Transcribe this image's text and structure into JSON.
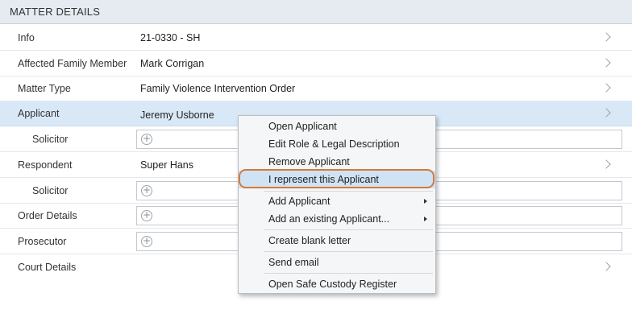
{
  "header": {
    "title": "MATTER DETAILS"
  },
  "rows": {
    "info": {
      "label": "Info",
      "value": "21-0330 - SH"
    },
    "affected": {
      "label": "Affected Family Member",
      "value": "Mark Corrigan"
    },
    "matter_type": {
      "label": "Matter Type",
      "value": "Family Violence Intervention Order"
    },
    "applicant": {
      "label": "Applicant",
      "value": "Jeremy Usborne"
    },
    "applicant_solicitor": {
      "label": "Solicitor",
      "add_symbol": "+"
    },
    "respondent": {
      "label": "Respondent",
      "value": "Super Hans"
    },
    "respondent_solicitor": {
      "label": "Solicitor",
      "add_symbol": "+"
    },
    "order_details": {
      "label": "Order Details",
      "add_symbol": "+"
    },
    "prosecutor": {
      "label": "Prosecutor",
      "add_symbol": "+"
    },
    "court_details": {
      "label": "Court Details"
    }
  },
  "context_menu": {
    "open_applicant": "Open Applicant",
    "edit_role": "Edit Role & Legal Description",
    "remove_applicant": "Remove Applicant",
    "i_represent": "I represent this Applicant",
    "add_applicant": "Add Applicant",
    "add_existing": "Add an existing Applicant...",
    "create_letter": "Create blank letter",
    "send_email": "Send email",
    "safe_custody": "Open Safe Custody Register"
  },
  "icons": {
    "chevron": "chevron-right-icon",
    "add": "add-circle-icon",
    "submenu": "submenu-arrow-icon"
  },
  "colors": {
    "header_bg": "#e6ebf1",
    "selected_row": "#d9e8f7",
    "menu_hover": "#cfe3f4",
    "highlight_ring": "#d6793b"
  }
}
